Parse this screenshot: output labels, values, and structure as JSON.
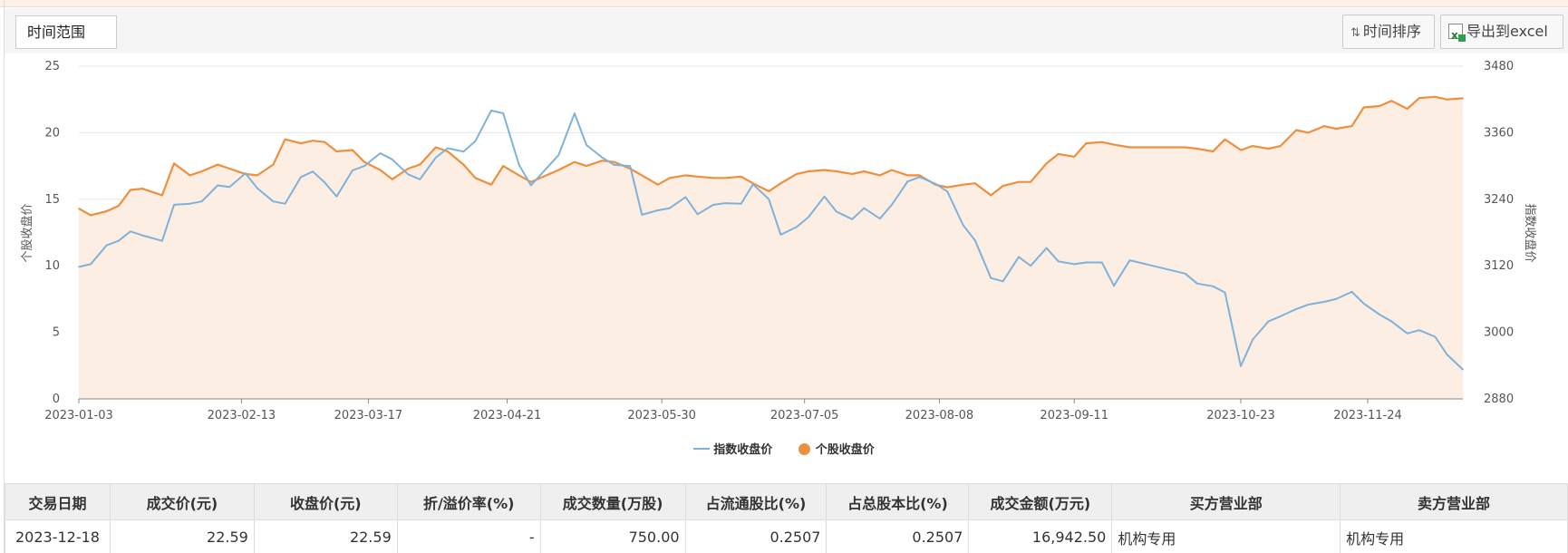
{
  "toolbar": {
    "range_label": "时间范围",
    "sort_label": "时间排序",
    "export_label": "导出到excel",
    "sort_icon": "sort-arrows-icon",
    "export_icon": "excel-icon"
  },
  "chart_data": {
    "type": "line",
    "x_ticks": [
      "2023-01-03",
      "2023-02-13",
      "2023-03-17",
      "2023-04-21",
      "2023-05-30",
      "2023-07-05",
      "2023-08-08",
      "2023-09-11",
      "2023-10-23",
      "2023-11-24"
    ],
    "x_range": [
      "2023-01-03",
      "2023-12-18"
    ],
    "y_left": {
      "label": "个股收盘价",
      "ticks": [
        0,
        5,
        10,
        15,
        20,
        25
      ],
      "range": [
        0,
        25
      ]
    },
    "y_right": {
      "label": "指数收盘价",
      "ticks": [
        2880,
        3000,
        3120,
        3240,
        3360,
        3480
      ],
      "range": [
        2880,
        3480
      ]
    },
    "grid": true,
    "legend_position": "bottom",
    "series": [
      {
        "name": "指数收盘价",
        "axis": "right",
        "color": "#7fb2da",
        "points": [
          [
            "2023-01-03",
            3118
          ],
          [
            "2023-01-06",
            3123
          ],
          [
            "2023-01-10",
            3157
          ],
          [
            "2023-01-13",
            3165
          ],
          [
            "2023-01-16",
            3182
          ],
          [
            "2023-01-19",
            3175
          ],
          [
            "2023-01-24",
            3165
          ],
          [
            "2023-01-27",
            3230
          ],
          [
            "2023-01-31",
            3232
          ],
          [
            "2023-02-03",
            3236
          ],
          [
            "2023-02-07",
            3265
          ],
          [
            "2023-02-10",
            3262
          ],
          [
            "2023-02-14",
            3287
          ],
          [
            "2023-02-17",
            3260
          ],
          [
            "2023-02-21",
            3236
          ],
          [
            "2023-02-24",
            3232
          ],
          [
            "2023-02-28",
            3280
          ],
          [
            "2023-03-03",
            3290
          ],
          [
            "2023-03-06",
            3270
          ],
          [
            "2023-03-09",
            3245
          ],
          [
            "2023-03-13",
            3292
          ],
          [
            "2023-03-16",
            3300
          ],
          [
            "2023-03-20",
            3323
          ],
          [
            "2023-03-23",
            3312
          ],
          [
            "2023-03-27",
            3285
          ],
          [
            "2023-03-30",
            3276
          ],
          [
            "2023-04-03",
            3315
          ],
          [
            "2023-04-06",
            3332
          ],
          [
            "2023-04-10",
            3326
          ],
          [
            "2023-04-13",
            3345
          ],
          [
            "2023-04-17",
            3400
          ],
          [
            "2023-04-20",
            3395
          ],
          [
            "2023-04-24",
            3302
          ],
          [
            "2023-04-27",
            3265
          ],
          [
            "2023-05-04",
            3320
          ],
          [
            "2023-05-08",
            3395
          ],
          [
            "2023-05-11",
            3338
          ],
          [
            "2023-05-15",
            3315
          ],
          [
            "2023-05-18",
            3302
          ],
          [
            "2023-05-22",
            3300
          ],
          [
            "2023-05-25",
            3212
          ],
          [
            "2023-05-29",
            3220
          ],
          [
            "2023-06-01",
            3224
          ],
          [
            "2023-06-05",
            3244
          ],
          [
            "2023-06-08",
            3213
          ],
          [
            "2023-06-12",
            3230
          ],
          [
            "2023-06-15",
            3233
          ],
          [
            "2023-06-19",
            3232
          ],
          [
            "2023-06-22",
            3267
          ],
          [
            "2023-06-26",
            3240
          ],
          [
            "2023-06-29",
            3176
          ],
          [
            "2023-07-03",
            3190
          ],
          [
            "2023-07-06",
            3208
          ],
          [
            "2023-07-10",
            3245
          ],
          [
            "2023-07-13",
            3218
          ],
          [
            "2023-07-17",
            3204
          ],
          [
            "2023-07-20",
            3224
          ],
          [
            "2023-07-24",
            3205
          ],
          [
            "2023-07-27",
            3230
          ],
          [
            "2023-07-31",
            3272
          ],
          [
            "2023-08-03",
            3280
          ],
          [
            "2023-08-07",
            3268
          ],
          [
            "2023-08-10",
            3254
          ],
          [
            "2023-08-14",
            3193
          ],
          [
            "2023-08-17",
            3166
          ],
          [
            "2023-08-21",
            3098
          ],
          [
            "2023-08-24",
            3092
          ],
          [
            "2023-08-28",
            3136
          ],
          [
            "2023-08-31",
            3120
          ],
          [
            "2023-09-04",
            3152
          ],
          [
            "2023-09-07",
            3128
          ],
          [
            "2023-09-11",
            3123
          ],
          [
            "2023-09-14",
            3126
          ],
          [
            "2023-09-18",
            3126
          ],
          [
            "2023-09-21",
            3084
          ],
          [
            "2023-09-25",
            3130
          ],
          [
            "2023-10-09",
            3106
          ],
          [
            "2023-10-12",
            3088
          ],
          [
            "2023-10-16",
            3083
          ],
          [
            "2023-10-19",
            3072
          ],
          [
            "2023-10-23",
            2939
          ],
          [
            "2023-10-26",
            2987
          ],
          [
            "2023-10-30",
            3020
          ],
          [
            "2023-11-02",
            3029
          ],
          [
            "2023-11-06",
            3042
          ],
          [
            "2023-11-09",
            3050
          ],
          [
            "2023-11-13",
            3055
          ],
          [
            "2023-11-16",
            3060
          ],
          [
            "2023-11-20",
            3073
          ],
          [
            "2023-11-23",
            3052
          ],
          [
            "2023-11-27",
            3032
          ],
          [
            "2023-11-30",
            3020
          ],
          [
            "2023-12-04",
            2998
          ],
          [
            "2023-12-07",
            3004
          ],
          [
            "2023-12-11",
            2992
          ],
          [
            "2023-12-14",
            2960
          ],
          [
            "2023-12-18",
            2933
          ]
        ]
      },
      {
        "name": "个股收盘价",
        "axis": "left",
        "color": "#ee8f3e",
        "points": [
          [
            "2023-01-03",
            14.3
          ],
          [
            "2023-01-06",
            13.8
          ],
          [
            "2023-01-10",
            14.1
          ],
          [
            "2023-01-13",
            14.5
          ],
          [
            "2023-01-16",
            15.7
          ],
          [
            "2023-01-19",
            15.8
          ],
          [
            "2023-01-24",
            15.3
          ],
          [
            "2023-01-27",
            17.7
          ],
          [
            "2023-01-31",
            16.8
          ],
          [
            "2023-02-03",
            17.1
          ],
          [
            "2023-02-07",
            17.6
          ],
          [
            "2023-02-10",
            17.3
          ],
          [
            "2023-02-14",
            16.9
          ],
          [
            "2023-02-17",
            16.8
          ],
          [
            "2023-02-21",
            17.6
          ],
          [
            "2023-02-24",
            19.5
          ],
          [
            "2023-02-28",
            19.2
          ],
          [
            "2023-03-03",
            19.4
          ],
          [
            "2023-03-06",
            19.3
          ],
          [
            "2023-03-09",
            18.6
          ],
          [
            "2023-03-13",
            18.7
          ],
          [
            "2023-03-16",
            17.8
          ],
          [
            "2023-03-20",
            17.2
          ],
          [
            "2023-03-23",
            16.5
          ],
          [
            "2023-03-27",
            17.3
          ],
          [
            "2023-03-30",
            17.6
          ],
          [
            "2023-04-03",
            18.9
          ],
          [
            "2023-04-06",
            18.6
          ],
          [
            "2023-04-10",
            17.6
          ],
          [
            "2023-04-13",
            16.6
          ],
          [
            "2023-04-17",
            16.1
          ],
          [
            "2023-04-20",
            17.5
          ],
          [
            "2023-04-24",
            16.8
          ],
          [
            "2023-04-27",
            16.3
          ],
          [
            "2023-05-04",
            17.2
          ],
          [
            "2023-05-08",
            17.8
          ],
          [
            "2023-05-11",
            17.5
          ],
          [
            "2023-05-15",
            17.9
          ],
          [
            "2023-05-18",
            17.8
          ],
          [
            "2023-05-22",
            17.3
          ],
          [
            "2023-05-25",
            16.8
          ],
          [
            "2023-05-29",
            16.1
          ],
          [
            "2023-06-01",
            16.6
          ],
          [
            "2023-06-05",
            16.8
          ],
          [
            "2023-06-08",
            16.7
          ],
          [
            "2023-06-12",
            16.6
          ],
          [
            "2023-06-15",
            16.6
          ],
          [
            "2023-06-19",
            16.7
          ],
          [
            "2023-06-22",
            16.2
          ],
          [
            "2023-06-26",
            15.6
          ],
          [
            "2023-06-29",
            16.2
          ],
          [
            "2023-07-03",
            16.9
          ],
          [
            "2023-07-06",
            17.1
          ],
          [
            "2023-07-10",
            17.2
          ],
          [
            "2023-07-13",
            17.1
          ],
          [
            "2023-07-17",
            16.9
          ],
          [
            "2023-07-20",
            17.1
          ],
          [
            "2023-07-24",
            16.8
          ],
          [
            "2023-07-27",
            17.2
          ],
          [
            "2023-07-31",
            16.8
          ],
          [
            "2023-08-03",
            16.8
          ],
          [
            "2023-08-07",
            16.1
          ],
          [
            "2023-08-10",
            15.9
          ],
          [
            "2023-08-14",
            16.1
          ],
          [
            "2023-08-17",
            16.2
          ],
          [
            "2023-08-21",
            15.3
          ],
          [
            "2023-08-24",
            16.0
          ],
          [
            "2023-08-28",
            16.3
          ],
          [
            "2023-08-31",
            16.3
          ],
          [
            "2023-09-04",
            17.7
          ],
          [
            "2023-09-07",
            18.4
          ],
          [
            "2023-09-11",
            18.2
          ],
          [
            "2023-09-14",
            19.2
          ],
          [
            "2023-09-18",
            19.3
          ],
          [
            "2023-09-21",
            19.1
          ],
          [
            "2023-09-25",
            18.9
          ],
          [
            "2023-10-09",
            18.9
          ],
          [
            "2023-10-12",
            18.8
          ],
          [
            "2023-10-16",
            18.6
          ],
          [
            "2023-10-19",
            19.5
          ],
          [
            "2023-10-23",
            18.7
          ],
          [
            "2023-10-26",
            19.0
          ],
          [
            "2023-10-30",
            18.8
          ],
          [
            "2023-11-02",
            19.0
          ],
          [
            "2023-11-06",
            20.2
          ],
          [
            "2023-11-09",
            20.0
          ],
          [
            "2023-11-13",
            20.5
          ],
          [
            "2023-11-16",
            20.3
          ],
          [
            "2023-11-20",
            20.5
          ],
          [
            "2023-11-23",
            21.9
          ],
          [
            "2023-11-27",
            22.0
          ],
          [
            "2023-11-30",
            22.4
          ],
          [
            "2023-12-04",
            21.8
          ],
          [
            "2023-12-07",
            22.6
          ],
          [
            "2023-12-11",
            22.7
          ],
          [
            "2023-12-14",
            22.5
          ],
          [
            "2023-12-18",
            22.59
          ]
        ]
      }
    ]
  },
  "table": {
    "headers": [
      "交易日期",
      "成交价(元)",
      "收盘价(元)",
      "折/溢价率(%)",
      "成交数量(万股)",
      "占流通股比(%)",
      "占总股本比(%)",
      "成交金额(万元)",
      "买方营业部",
      "卖方营业部"
    ],
    "rows": [
      [
        "2023-12-18",
        "22.59",
        "22.59",
        "-",
        "750.00",
        "0.2507",
        "0.2507",
        "16,942.50",
        "机构专用",
        "机构专用"
      ]
    ]
  }
}
